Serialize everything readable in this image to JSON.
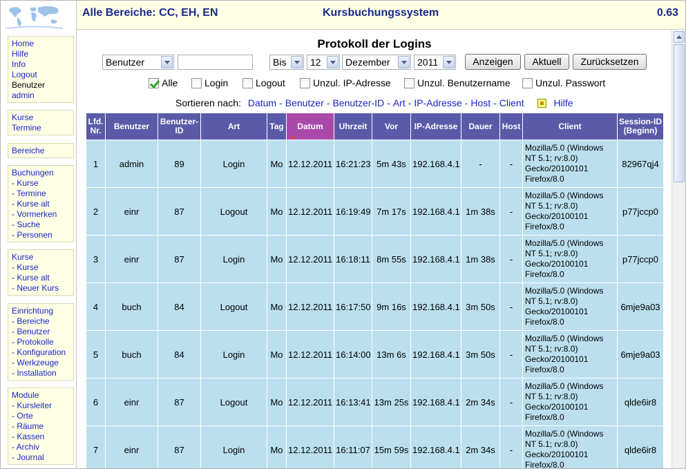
{
  "header": {
    "scope": "Alle Bereiche: CC, EH, EN",
    "app_title": "Kursbuchungssystem",
    "version": "0.63"
  },
  "sidebar": {
    "groups": [
      {
        "items": [
          {
            "label": "Home",
            "link": true
          },
          {
            "label": "Hilfe",
            "link": true
          },
          {
            "label": "Info",
            "link": true
          },
          {
            "label": "Logout",
            "link": true
          },
          {
            "label": "Benutzer",
            "link": false
          },
          {
            "label": "admin",
            "link": true
          }
        ]
      },
      {
        "items": [
          {
            "label": "Kurse",
            "link": true
          },
          {
            "label": "Termine",
            "link": true
          }
        ]
      },
      {
        "items": [
          {
            "label": "Bereiche",
            "link": true
          }
        ]
      },
      {
        "items": [
          {
            "label": "Buchungen",
            "link": true
          },
          {
            "label": "- Kurse",
            "link": true
          },
          {
            "label": "- Termine",
            "link": true
          },
          {
            "label": "- Kurse alt",
            "link": true
          },
          {
            "label": "- Vormerken",
            "link": true
          },
          {
            "label": "- Suche",
            "link": true
          },
          {
            "label": "- Personen",
            "link": true
          }
        ]
      },
      {
        "items": [
          {
            "label": "Kurse",
            "link": true
          },
          {
            "label": "- Kurse",
            "link": true
          },
          {
            "label": "- Kurse alt",
            "link": true
          },
          {
            "label": "- Neuer Kurs",
            "link": true
          }
        ]
      },
      {
        "items": [
          {
            "label": "Einrichtung",
            "link": true
          },
          {
            "label": "- Bereiche",
            "link": true
          },
          {
            "label": "- Benutzer",
            "link": true
          },
          {
            "label": "- Protokolle",
            "link": true
          },
          {
            "label": "- Konfiguration",
            "link": true
          },
          {
            "label": "- Werkzeuge",
            "link": true
          },
          {
            "label": "- Installation",
            "link": true
          }
        ]
      },
      {
        "items": [
          {
            "label": "Module",
            "link": true
          },
          {
            "label": "- Kursleiter",
            "link": true
          },
          {
            "label": "- Orte",
            "link": true
          },
          {
            "label": "- Räume",
            "link": true
          },
          {
            "label": "- Kassen",
            "link": true
          },
          {
            "label": "- Archiv",
            "link": true
          },
          {
            "label": "- Journal",
            "link": true
          }
        ]
      }
    ]
  },
  "page": {
    "title": "Protokoll der Logins"
  },
  "filter": {
    "field_select": "Benutzer",
    "search_value": "",
    "bound_select": "Bis",
    "day_select": "12",
    "month_select": "Dezember",
    "year_select": "2011",
    "show_button": "Anzeigen",
    "current_button": "Aktuell",
    "reset_button": "Zurücksetzen"
  },
  "checkboxes": [
    {
      "label": "Alle",
      "checked": true
    },
    {
      "label": "Login",
      "checked": false
    },
    {
      "label": "Logout",
      "checked": false
    },
    {
      "label": "Unzul. IP-Adresse",
      "checked": false
    },
    {
      "label": "Unzul. Benutzername",
      "checked": false
    },
    {
      "label": "Unzul. Passwort",
      "checked": false
    }
  ],
  "sort": {
    "label": "Sortieren nach:",
    "options": [
      "Datum",
      "Benutzer",
      "Benutzer-ID",
      "Art",
      "IP-Adresse",
      "Host",
      "Client"
    ],
    "help_label": "Hilfe"
  },
  "table": {
    "columns": [
      "Lfd. Nr.",
      "Benutzer",
      "Benutzer-ID",
      "Art",
      "Tag",
      "Datum",
      "Uhrzeit",
      "Vor",
      "IP-Adresse",
      "Dauer",
      "Host",
      "Client",
      "Session-ID (Beginn)"
    ],
    "rows": [
      [
        "1",
        "admin",
        "89",
        "Login",
        "Mo",
        "12.12.2011",
        "16:21:23",
        "5m 43s",
        "192.168.4.1",
        "-",
        "-",
        "Mozilla/5.0 (Windows NT 5.1; rv:8.0) Gecko/20100101 Firefox/8.0",
        "82967qj4"
      ],
      [
        "2",
        "einr",
        "87",
        "Logout",
        "Mo",
        "12.12.2011",
        "16:19:49",
        "7m 17s",
        "192.168.4.1",
        "1m 38s",
        "-",
        "Mozilla/5.0 (Windows NT 5.1; rv:8.0) Gecko/20100101 Firefox/8.0",
        "p77jccp0"
      ],
      [
        "3",
        "einr",
        "87",
        "Login",
        "Mo",
        "12.12.2011",
        "16:18:11",
        "8m 55s",
        "192.168.4.1",
        "1m 38s",
        "-",
        "Mozilla/5.0 (Windows NT 5.1; rv:8.0) Gecko/20100101 Firefox/8.0",
        "p77jccp0"
      ],
      [
        "4",
        "buch",
        "84",
        "Logout",
        "Mo",
        "12.12.2011",
        "16:17:50",
        "9m 16s",
        "192.168.4.1",
        "3m 50s",
        "-",
        "Mozilla/5.0 (Windows NT 5.1; rv:8.0) Gecko/20100101 Firefox/8.0",
        "6mje9a03"
      ],
      [
        "5",
        "buch",
        "84",
        "Login",
        "Mo",
        "12.12.2011",
        "16:14:00",
        "13m 6s",
        "192.168.4.1",
        "3m 50s",
        "-",
        "Mozilla/5.0 (Windows NT 5.1; rv:8.0) Gecko/20100101 Firefox/8.0",
        "6mje9a03"
      ],
      [
        "6",
        "einr",
        "87",
        "Logout",
        "Mo",
        "12.12.2011",
        "16:13:41",
        "13m 25s",
        "192.168.4.1",
        "2m 34s",
        "-",
        "Mozilla/5.0 (Windows NT 5.1; rv:8.0) Gecko/20100101 Firefox/8.0",
        "qlde6ir8"
      ],
      [
        "7",
        "einr",
        "87",
        "Login",
        "Mo",
        "12.12.2011",
        "16:11:07",
        "15m 59s",
        "192.168.4.1",
        "2m 34s",
        "-",
        "Mozilla/5.0 (Windows NT 5.1; rv:8.0) Gecko/20100101 Firefox/8.0",
        "qlde6ir8"
      ]
    ]
  }
}
